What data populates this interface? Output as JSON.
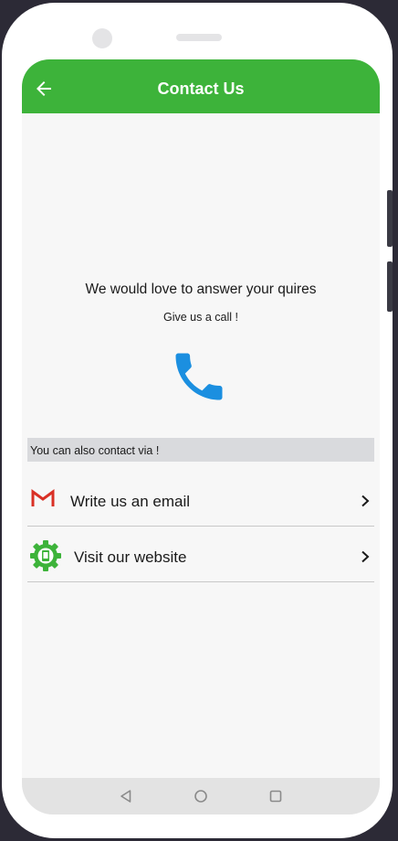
{
  "app_bar": {
    "title": "Contact Us",
    "back_icon": "arrow-left-icon"
  },
  "intro": {
    "title": "We would love to answer your quires",
    "subtitle": "Give us a call !",
    "call_icon": "phone-icon"
  },
  "contact_section": {
    "label": "You can also contact via !"
  },
  "contact_options": [
    {
      "label": "Write us an email",
      "icon": "gmail-icon"
    },
    {
      "label": "Visit our website",
      "icon": "website-gear-icon"
    }
  ],
  "nav_bar": {
    "buttons": [
      "back-triangle-icon",
      "home-circle-icon",
      "recents-square-icon"
    ]
  },
  "colors": {
    "accent": "#3db33a",
    "call_icon": "#1b8fe0",
    "section_bg": "#d9dadd"
  }
}
